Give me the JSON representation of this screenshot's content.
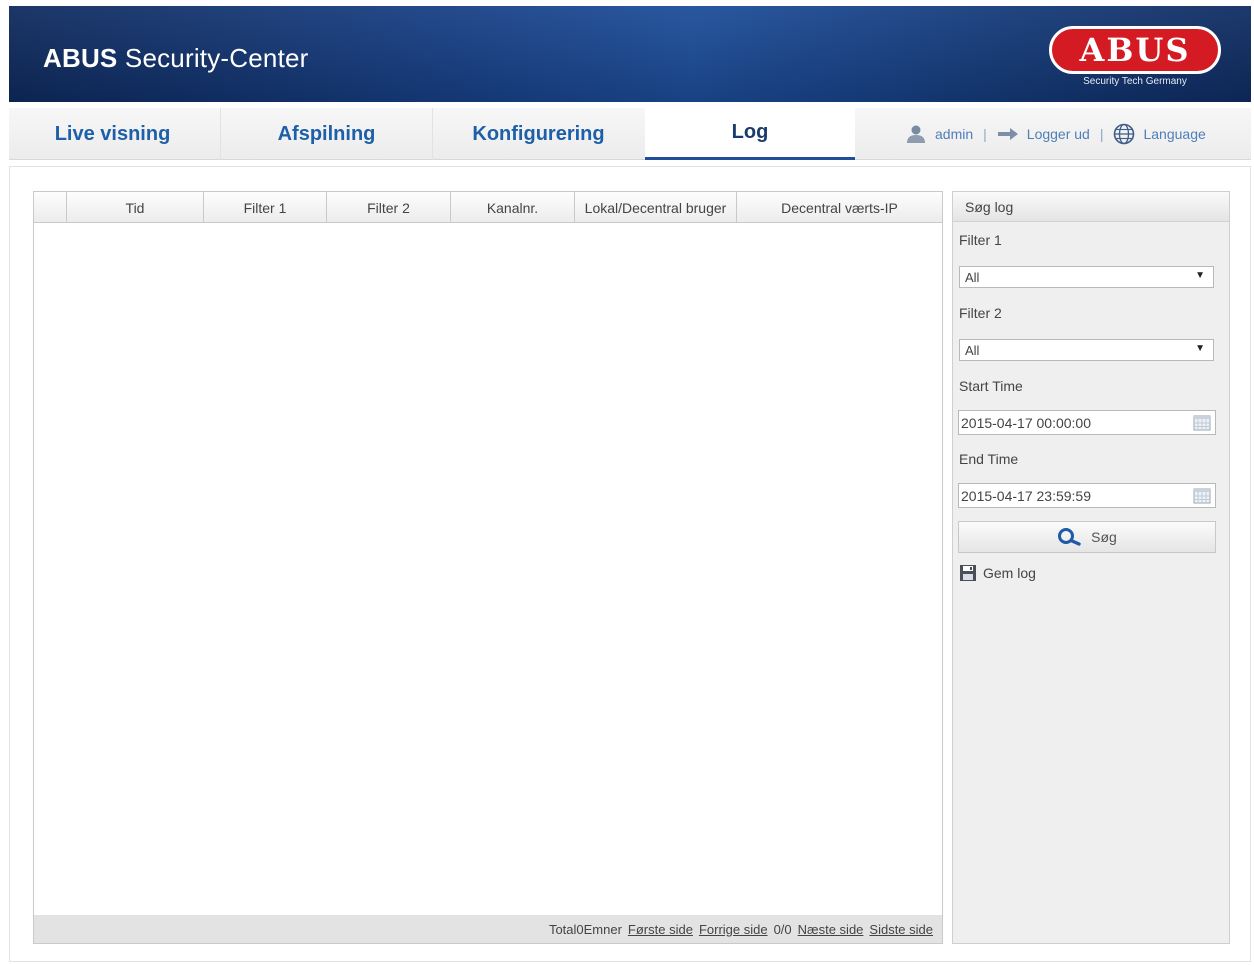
{
  "header": {
    "brand_bold": "ABUS",
    "brand_rest": " Security-Center",
    "logo_text": "ABUS",
    "logo_sub": "Security Tech Germany",
    "colors": {
      "banner": "#173f85",
      "logo_red": "#d41a22"
    }
  },
  "nav": {
    "tabs": [
      {
        "label": "Live visning"
      },
      {
        "label": "Afspilning"
      },
      {
        "label": "Konfigurering"
      },
      {
        "label": "Log",
        "active": true
      }
    ],
    "user": "admin",
    "logout": "Logger ud",
    "language": "Language",
    "separator": "|",
    "icons": [
      "user-icon",
      "logout-icon",
      "globe-icon"
    ]
  },
  "table": {
    "columns": [
      "",
      "Tid",
      "Filter 1",
      "Filter 2",
      "Kanalnr.",
      "Lokal/Decentral bruger",
      "Decentral værts-IP"
    ],
    "rows": [],
    "footer": {
      "total": "Total0Emner",
      "first": "Første side",
      "prev": "Forrige side",
      "page": "0/0",
      "next": "Næste side",
      "last": "Sidste side"
    }
  },
  "search_panel": {
    "title": "Søg log",
    "filter1_label": "Filter 1",
    "filter1_value": "All",
    "filter2_label": "Filter 2",
    "filter2_value": "All",
    "start_label": "Start Time",
    "start_value": "2015-04-17 00:00:00",
    "end_label": "End Time",
    "end_value": "2015-04-17 23:59:59",
    "search_button": "Søg",
    "save_log": "Gem log"
  }
}
